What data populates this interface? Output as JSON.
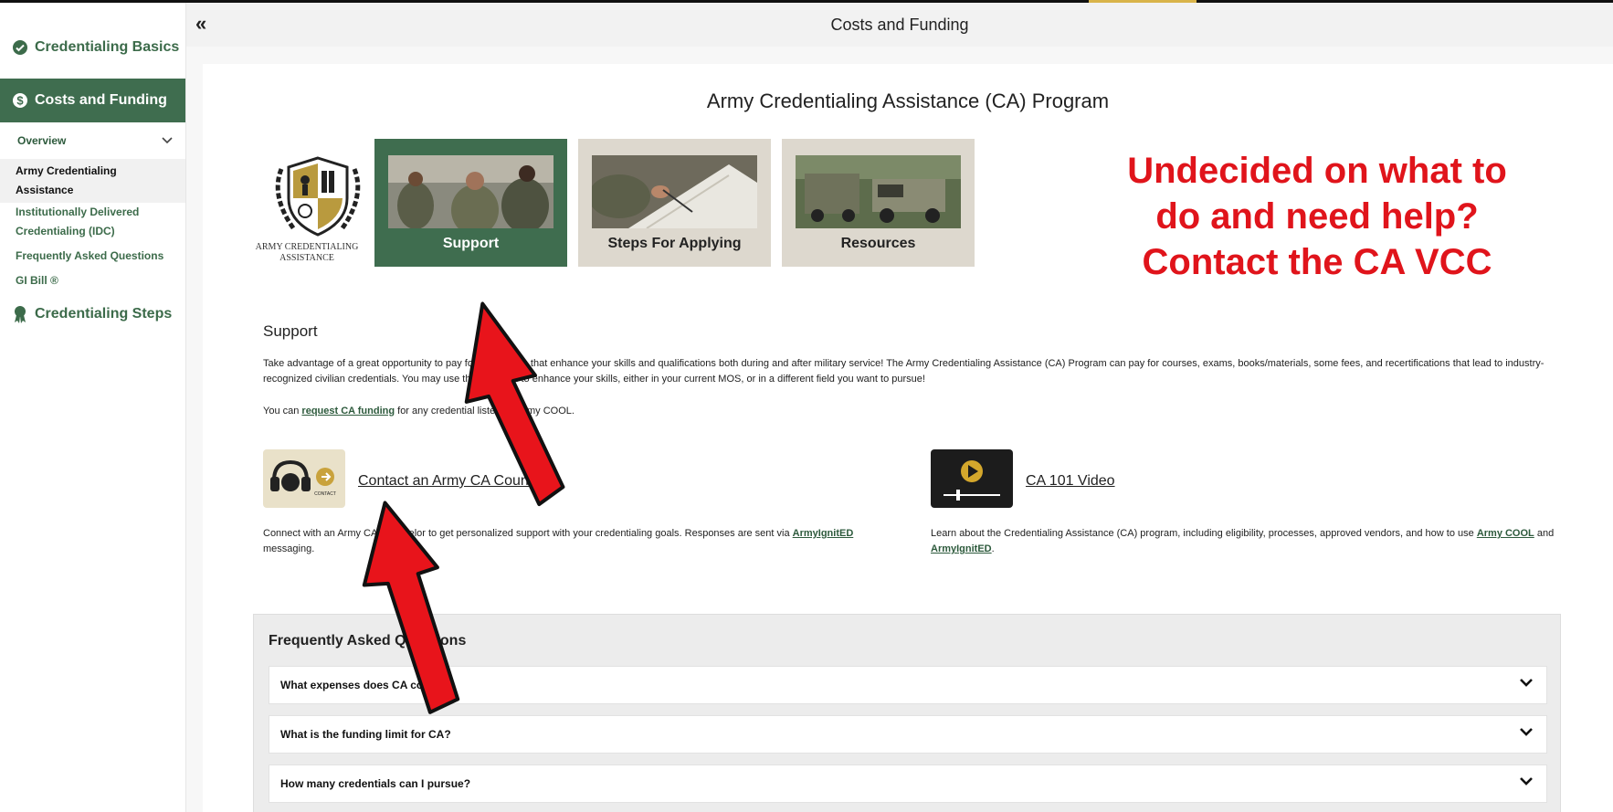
{
  "header": {
    "title": "Costs and Funding",
    "collapse_glyph": "«"
  },
  "sidebar": {
    "basics_label": "Credentialing Basics",
    "costs_label": "Costs and Funding",
    "overview_label": "Overview",
    "items": [
      "Army Credentialing Assistance",
      "Institutionally Delivered Credentialing (IDC)",
      "Frequently Asked Questions",
      "GI Bill ®"
    ],
    "steps_label": "Credentialing Steps"
  },
  "main": {
    "program_title": "Army Credentialing Assistance (CA) Program",
    "logo_text": "ARMY CREDENTIALING ASSISTANCE",
    "cards": [
      "Support",
      "Steps For Applying",
      "Resources"
    ],
    "callout": [
      "Undecided on what to",
      "do and need help?",
      "Contact the CA VCC"
    ],
    "support_heading": "Support",
    "support_p1": "Take advantage of a great opportunity to pay for credentials that enhance your skills and qualifications both during and after military service! The Army Credentialing Assistance (CA) Program can pay for courses, exams, books/materials, some fees, and recertifications that lead to industry-recognized civilian credentials. You may use this program to enhance your skills, either in your current MOS, or in a different field you want to pursue!",
    "support_p2_pre": "You can ",
    "support_p2_link": "request CA funding",
    "support_p2_post": " for any credential listed on Army COOL.",
    "contact_link": "Contact an Army CA Counselor",
    "contact_tile_text": "CONTACT",
    "contact_desc_pre": "Connect with an Army CA Counselor to get personalized support with your credentialing goals. Responses are sent via ",
    "contact_desc_link": "ArmyIgnitED",
    "contact_desc_post": " messaging.",
    "video_link": "CA 101 Video",
    "video_desc_pre": "Learn about the Credentialing Assistance (CA) program, including eligibility, processes, approved vendors, and how to use ",
    "video_desc_link1": "Army COOL",
    "video_desc_mid": " and ",
    "video_desc_link2": "ArmyIgnitED",
    "video_desc_post": "."
  },
  "faq": {
    "title": "Frequently Asked Questions",
    "items": [
      "What expenses does CA cover?",
      "What is the funding limit for CA?",
      "How many credentials can I pursue?"
    ]
  },
  "colors": {
    "brand_green": "#3f6d4f",
    "callout_red": "#e0141b",
    "card_tan": "#ddd8ce",
    "accent_gold": "#d9b44a"
  }
}
